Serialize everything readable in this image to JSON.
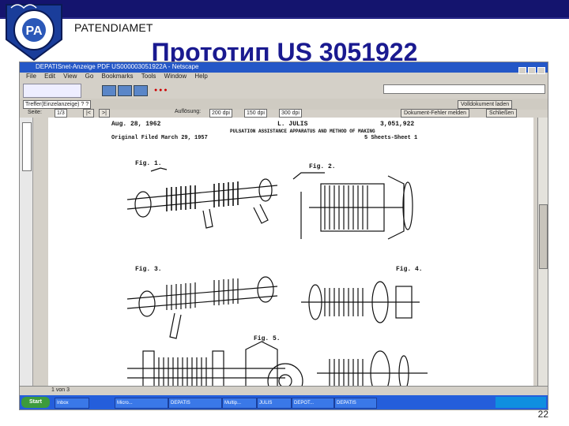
{
  "slide": {
    "org_name": "PATENDIAMET",
    "title": "Прототип US 3051922",
    "page_number": "22"
  },
  "screenshot": {
    "window_title": "DEPATISnet-Anzeige PDF US000003051922A - Netscape",
    "menu": [
      "File",
      "Edit",
      "View",
      "Go",
      "Bookmarks",
      "Tools",
      "Window",
      "Help"
    ],
    "toolbar2": {
      "tab_label": "Treffer(Einzelanzeige) ? ?",
      "page_label": "Seite:",
      "page_value": "1/3",
      "resolution_label": "Auflösung:",
      "res_options": [
        "200 dpi",
        "150 dpi",
        "300 dpi"
      ],
      "buttons_right": [
        "Volldokument laden",
        "Dokument-Fehler melden",
        "Schließen"
      ]
    },
    "document": {
      "date": "Aug. 28, 1962",
      "inventor": "L. JULIS",
      "patent_no": "3,051,922",
      "subtitle": "PULSATION ASSISTANCE APPARATUS AND METHOD OF MAKING",
      "filed": "Original Filed March 29, 1957",
      "sheets": "5 Sheets-Sheet 1",
      "figures": [
        "Fig. 1.",
        "Fig. 2.",
        "Fig. 3.",
        "Fig. 4.",
        "Fig. 5."
      ]
    },
    "status_bar": "1 von 3",
    "taskbar": {
      "start": "Start",
      "items": [
        "Inbox",
        "Micro...",
        "DEPATIS",
        "Multip...",
        "JULIS",
        "DEPOT...",
        "DEPATIS"
      ]
    }
  }
}
